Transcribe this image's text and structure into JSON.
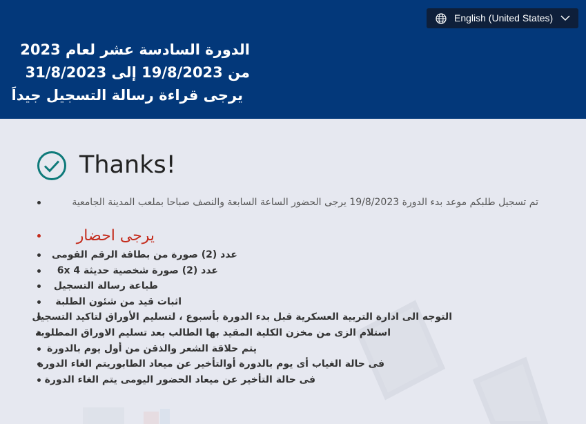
{
  "header": {
    "language_selector": {
      "label": "English (United States)",
      "icon": "globe-icon",
      "dropdown_icon": "chevron-down-icon"
    },
    "lines": [
      "الدورة السادسة عشر لعام 2023",
      "من 19/8/2023 إلى 31/8/2023",
      "يرجى قراءة رسالة التسجيل جيداَ"
    ]
  },
  "main": {
    "heading": "Thanks!",
    "status_icon": "checkmark-circle-icon",
    "intro": "تم تسجيل طلبكم موعد بدء الدورة 19/8/2023 يرجى الحضور الساعة السابعة والنصف صباحا بملعب المدينة الجامعية",
    "bring_label": "يرجى احضار",
    "requirements": [
      "عدد (2) صورة من بطاقة الرقم القومى",
      "عدد (2) صورة شخصية حديثة 4 6x",
      "طباعة رسالة التسجيل",
      "اثبات قيد من شئون الطلبة",
      "التوجه الى ادارة التربية العسكرية قبل بدء الدورة بأسبوع ، لتسليم الأوراق لتاكيد التسجيل",
      "استلام الزى من مخزن الكلية المقيد بها الطالب بعد تسليم الاوراق المطلوبة",
      "يتم حلاقة الشعر والذقن من أول يوم بالدورة",
      "فى حالة الغياب أى يوم بالدورة أوالتأخير عن ميعاد الطابوريتم الغاء الدورة",
      "فى حالة التأخير عن ميعاد الحضور اليومى يتم الغاء الدورة"
    ]
  },
  "colors": {
    "header_bg": "#03387a",
    "page_bg": "#e6e8f0",
    "accent_check": "#0e7a7a",
    "bring_red": "#c42b1c"
  }
}
